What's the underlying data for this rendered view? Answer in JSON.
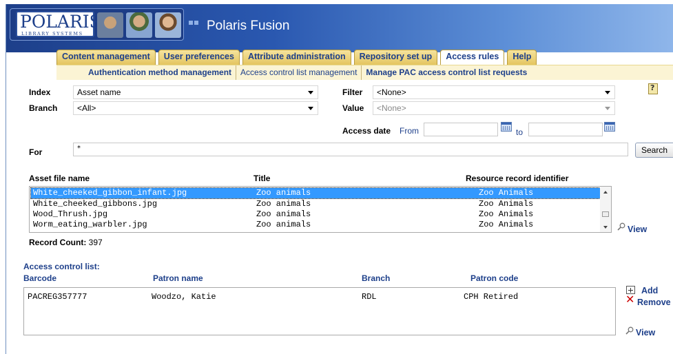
{
  "app": {
    "logo_text": "POLARIS",
    "logo_subtext": "LIBRARY SYSTEMS",
    "title": "Polaris Fusion"
  },
  "tabs": [
    {
      "label": "Content management",
      "active": false
    },
    {
      "label": "User preferences",
      "active": false
    },
    {
      "label": "Attribute administration",
      "active": false
    },
    {
      "label": "Repository set up",
      "active": false
    },
    {
      "label": "Access rules",
      "active": true
    },
    {
      "label": "Help",
      "active": false
    }
  ],
  "subnav": [
    {
      "label": "Authentication method management",
      "active": false
    },
    {
      "label": "Access control list management",
      "active": true
    },
    {
      "label": "Manage PAC access control list requests",
      "active": false
    }
  ],
  "form": {
    "index_label": "Index",
    "index_value": "Asset name",
    "branch_label": "Branch",
    "branch_value": "<All>",
    "filter_label": "Filter",
    "filter_value": "<None>",
    "value_label": "Value",
    "value_value": "<None>",
    "access_date_label": "Access date",
    "from_label": "From",
    "to_label": "to",
    "from_value": "",
    "to_value": "",
    "for_label": "For",
    "for_value": "*",
    "search_label": "Search"
  },
  "assets": {
    "columns": [
      "Asset file name",
      "Title",
      "Resource record identifier"
    ],
    "rows": [
      {
        "file": "White_cheeked_gibbon_infant.jpg",
        "title": "Zoo animals",
        "rri": "Zoo Animals",
        "selected": true
      },
      {
        "file": "White_cheeked_gibbons.jpg",
        "title": "Zoo animals",
        "rri": "Zoo Animals",
        "selected": false
      },
      {
        "file": "Wood_Thrush.jpg",
        "title": "Zoo animals",
        "rri": "Zoo Animals",
        "selected": false
      },
      {
        "file": "Worm_eating_warbler.jpg",
        "title": "Zoo animals",
        "rri": "Zoo Animals",
        "selected": false
      }
    ],
    "view_label": "View",
    "record_count_label": "Record Count:",
    "record_count_value": "397"
  },
  "acl": {
    "heading": "Access control list:",
    "columns": [
      "Barcode",
      "Patron name",
      "Branch",
      "Patron code"
    ],
    "rows": [
      {
        "barcode": "PACREG357777",
        "patron_name": "Woodzo, Katie",
        "branch": "RDL",
        "patron_code": "CPH Retired"
      }
    ],
    "add_label": "Add",
    "remove_label": "Remove",
    "view_label": "View"
  },
  "colors": {
    "brand_blue": "#1d3f8a",
    "tab_gold": "#e4c560",
    "selection": "#3399ff"
  }
}
